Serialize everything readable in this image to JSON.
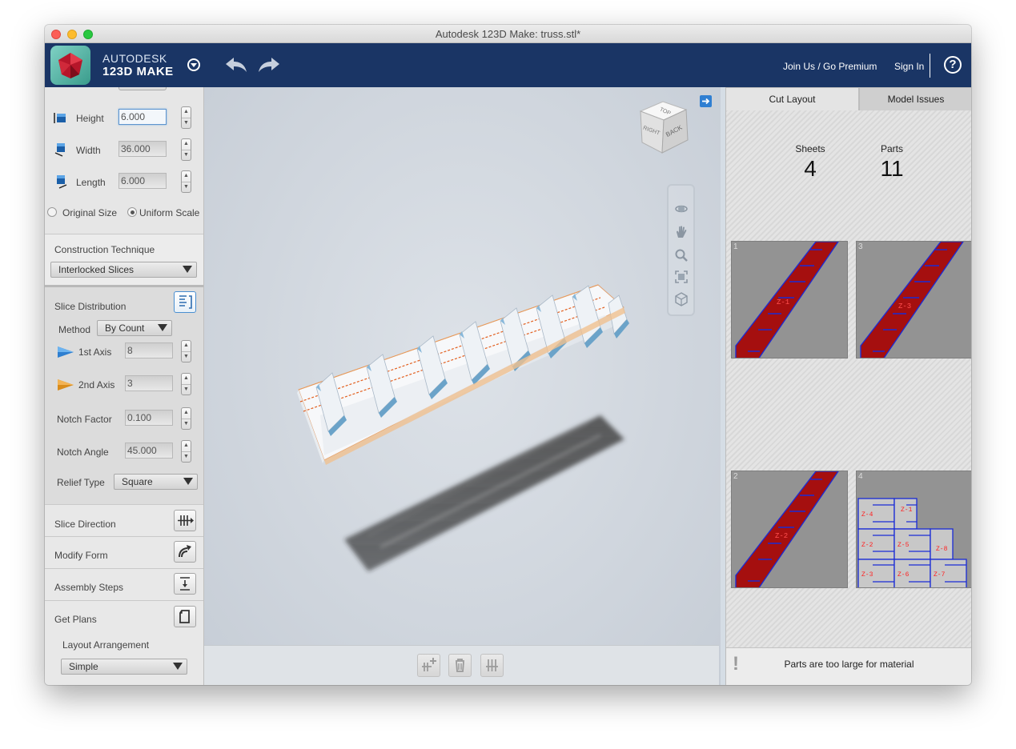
{
  "window": {
    "title": "Autodesk 123D Make: truss.stl*"
  },
  "header": {
    "brand_line1": "AUTODESK",
    "brand_line2": "123D MAKE",
    "join_label": "Join Us / Go Premium",
    "signin_label": "Sign In",
    "help_label": "?"
  },
  "dimensions": {
    "height": {
      "label": "Height",
      "value": "6.000"
    },
    "width": {
      "label": "Width",
      "value": "36.000"
    },
    "length": {
      "label": "Length",
      "value": "6.000"
    },
    "scale_options": [
      {
        "label": "Original Size",
        "selected": false
      },
      {
        "label": "Uniform Scale",
        "selected": true
      }
    ]
  },
  "construction": {
    "label": "Construction Technique",
    "value": "Interlocked Slices"
  },
  "slice_distribution": {
    "title": "Slice Distribution",
    "method_label": "Method",
    "method_value": "By Count",
    "axis1_label": "1st Axis",
    "axis1_value": "8",
    "axis2_label": "2nd Axis",
    "axis2_value": "3",
    "notch_factor_label": "Notch Factor",
    "notch_factor_value": "0.100",
    "notch_angle_label": "Notch Angle",
    "notch_angle_value": "45.000",
    "relief_label": "Relief Type",
    "relief_value": "Square"
  },
  "sections": {
    "slice_direction": "Slice Direction",
    "modify_form": "Modify Form",
    "assembly_steps": "Assembly Steps",
    "get_plans": "Get Plans",
    "layout_arrangement_label": "Layout Arrangement",
    "layout_arrangement_value": "Simple"
  },
  "viewcube": {
    "top": "TOP",
    "right": "RIGHT",
    "back": "BACK"
  },
  "right_panel": {
    "tabs": [
      "Cut Layout",
      "Model Issues"
    ],
    "sheets_label": "Sheets",
    "sheets_value": "4",
    "parts_label": "Parts",
    "parts_value": "11",
    "sheets": [
      {
        "number": "1",
        "part_label": "Z-1"
      },
      {
        "number": "3",
        "part_label": "Z-3"
      },
      {
        "number": "2",
        "part_label": "Z-2"
      },
      {
        "number": "4",
        "part_labels": [
          "Z-4",
          "Z-1",
          "Z-2",
          "Z-5",
          "Z-8",
          "Z-3",
          "Z-6",
          "Z-7"
        ]
      }
    ],
    "status_icon": "!",
    "status_text": "Parts are too large for material"
  },
  "colors": {
    "header": "#1a3565",
    "part_red": "#a50f0f",
    "part_edge": "#1a2bd6"
  }
}
